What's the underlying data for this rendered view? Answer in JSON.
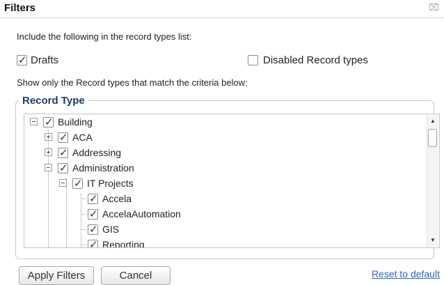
{
  "dialog": {
    "title": "Filters",
    "close_glyph": "⌧"
  },
  "include": {
    "instruction": "Include the following in the record types list:",
    "drafts": {
      "label": "Drafts",
      "checked": true
    },
    "disabled": {
      "label": "Disabled Record types",
      "checked": false
    }
  },
  "criteria_text": "Show only the Record types that match the criteria below:",
  "record_type": {
    "legend": "Record Type",
    "tree": [
      {
        "label": "Building",
        "level": 0,
        "toggle": "minus",
        "checked": true
      },
      {
        "label": "ACA",
        "level": 1,
        "toggle": "plus",
        "checked": true
      },
      {
        "label": "Addressing",
        "level": 1,
        "toggle": "plus",
        "checked": true
      },
      {
        "label": "Administration",
        "level": 1,
        "toggle": "minus",
        "checked": true
      },
      {
        "label": "IT Projects",
        "level": 2,
        "toggle": "minus",
        "checked": true
      },
      {
        "label": "Accela",
        "level": 3,
        "toggle": "leaf",
        "checked": true
      },
      {
        "label": "AccelaAutomation",
        "level": 3,
        "toggle": "leaf",
        "checked": true
      },
      {
        "label": "GIS",
        "level": 3,
        "toggle": "leaf",
        "checked": true
      },
      {
        "label": "Reporting",
        "level": 3,
        "toggle": "leaf",
        "checked": true
      }
    ]
  },
  "buttons": {
    "apply": "Apply Filters",
    "cancel": "Cancel",
    "reset": "Reset to default"
  }
}
